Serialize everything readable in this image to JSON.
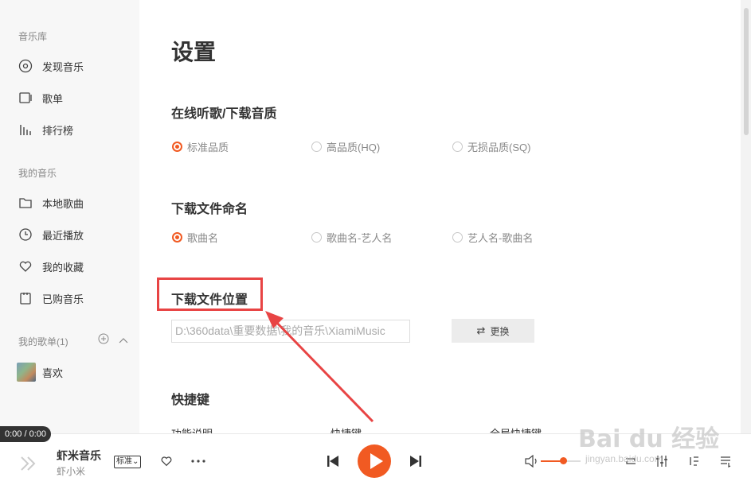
{
  "sidebar": {
    "library_title": "音乐库",
    "library_items": [
      {
        "label": "发现音乐",
        "icon": "disc-icon"
      },
      {
        "label": "歌单",
        "icon": "playlist-icon"
      },
      {
        "label": "排行榜",
        "icon": "chart-icon"
      }
    ],
    "my_music_title": "我的音乐",
    "my_music_items": [
      {
        "label": "本地歌曲",
        "icon": "folder-icon"
      },
      {
        "label": "最近播放",
        "icon": "clock-icon"
      },
      {
        "label": "我的收藏",
        "icon": "heart-icon"
      },
      {
        "label": "已购音乐",
        "icon": "purchase-icon"
      }
    ],
    "my_playlists_title": "我的歌单(1)",
    "playlists": [
      {
        "label": "喜欢"
      }
    ]
  },
  "main": {
    "title": "设置",
    "quality": {
      "heading": "在线听歌/下载音质",
      "options": [
        "标准品质",
        "高品质(HQ)",
        "无损品质(SQ)"
      ],
      "selected_index": 0
    },
    "naming": {
      "heading": "下载文件命名",
      "options": [
        "歌曲名",
        "歌曲名-艺人名",
        "艺人名-歌曲名"
      ],
      "selected_index": 0
    },
    "location": {
      "heading": "下载文件位置",
      "path": "D:\\360data\\重要数据\\我的音乐\\XiamiMusic",
      "change_label": "更换"
    },
    "shortcuts": {
      "heading": "快捷键",
      "columns": [
        "功能说明",
        "快捷键",
        "全局快捷键"
      ]
    }
  },
  "player": {
    "time": "0:00 / 0:00",
    "song_title": "虾米音乐",
    "artist": "虾小米",
    "quality_badge": "标准",
    "volume": 0.55
  },
  "watermark": {
    "text": "Bai du 经验",
    "sub": "jingyan.baidu.com"
  },
  "colors": {
    "accent": "#f15a22",
    "annotation": "#e84444"
  }
}
